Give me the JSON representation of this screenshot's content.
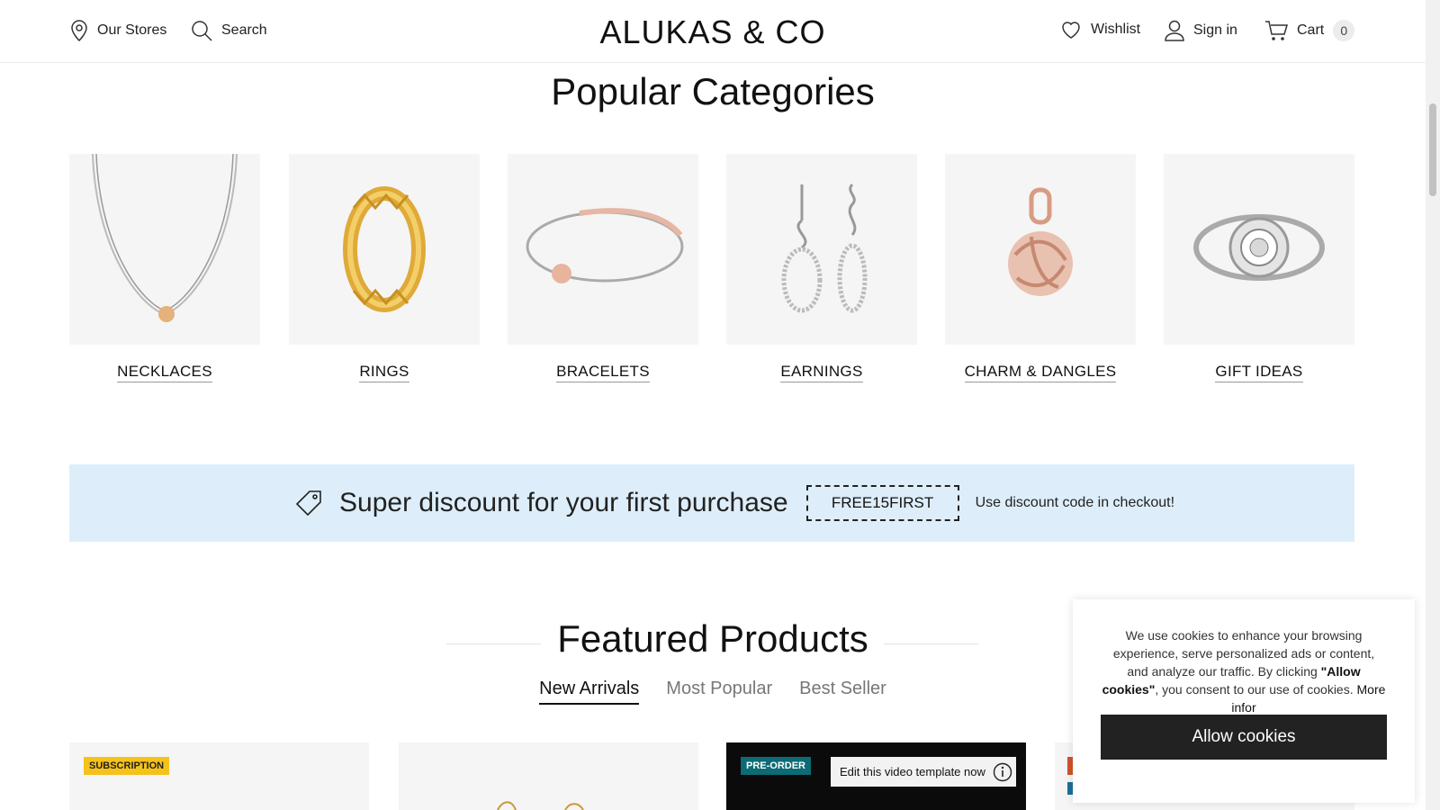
{
  "header": {
    "stores_label": "Our Stores",
    "search_label": "Search",
    "logo": "ALUKAS & CO",
    "wishlist_label": "Wishlist",
    "signin_label": "Sign in",
    "cart_label": "Cart",
    "cart_count": "0"
  },
  "categories": {
    "title": "Popular Categories",
    "items": [
      {
        "label": "NECKLACES",
        "icon": "necklace-image"
      },
      {
        "label": "RINGS",
        "icon": "ring-image"
      },
      {
        "label": "BRACELETS",
        "icon": "bracelet-image"
      },
      {
        "label": "EARNINGS",
        "icon": "earrings-image"
      },
      {
        "label": "CHARM & DANGLES",
        "icon": "charm-image"
      },
      {
        "label": "GIFT IDEAS",
        "icon": "gift-ring-image"
      }
    ]
  },
  "discount": {
    "text": "Super discount for your first purchase",
    "code": "FREE15FIRST",
    "note": "Use discount code in checkout!"
  },
  "featured": {
    "title": "Featured Products",
    "tabs": [
      "New Arrivals",
      "Most Popular",
      "Best Seller"
    ],
    "active_tab": "New Arrivals",
    "products": [
      {
        "badge": "SUBSCRIPTION"
      },
      {
        "badge": ""
      },
      {
        "badge": "PRE-ORDER",
        "video_label": "Edit this video template now"
      },
      {
        "badge": ""
      }
    ]
  },
  "cookie": {
    "text_before": "We use cookies to enhance your browsing experience, serve personalized ads or content, and analyze our traffic. By clicking ",
    "text_bold": "\"Allow cookies\"",
    "text_after": ", you consent to our use of cookies. ",
    "more_label": "More infor",
    "button_label": "Allow cookies"
  },
  "colors": {
    "discount_bg": "#ddeefa",
    "badge_subscription": "#f5c21b",
    "badge_preorder": "#0c6b74",
    "cookie_button": "#222222"
  }
}
